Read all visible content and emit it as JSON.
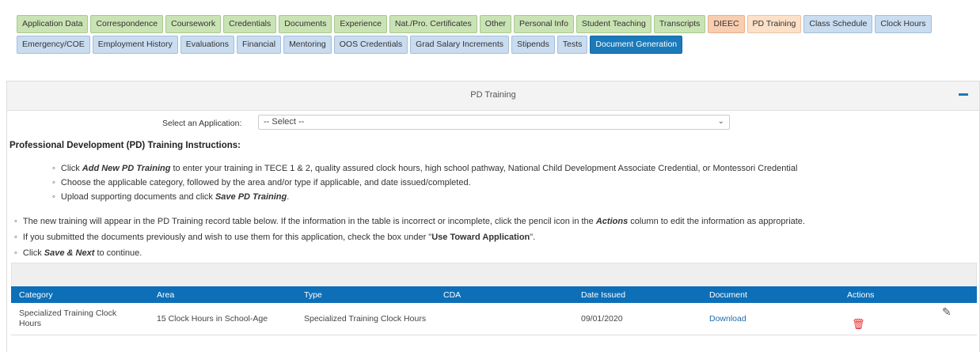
{
  "tabs": {
    "row1": [
      {
        "label": "Application Data",
        "color": "green"
      },
      {
        "label": "Correspondence",
        "color": "green"
      },
      {
        "label": "Coursework",
        "color": "green"
      },
      {
        "label": "Credentials",
        "color": "green"
      },
      {
        "label": "Documents",
        "color": "green"
      },
      {
        "label": "Experience",
        "color": "green"
      },
      {
        "label": "Nat./Pro. Certificates",
        "color": "green"
      },
      {
        "label": "Other",
        "color": "green"
      },
      {
        "label": "Personal Info",
        "color": "green"
      },
      {
        "label": "Student Teaching",
        "color": "green"
      },
      {
        "label": "Transcripts",
        "color": "green"
      },
      {
        "label": "DIEEC",
        "color": "orange"
      },
      {
        "label": "PD Training",
        "color": "peach"
      },
      {
        "label": "Class Schedule",
        "color": "blue"
      },
      {
        "label": "Clock Hours",
        "color": "blue"
      }
    ],
    "row2": [
      {
        "label": "Emergency/COE",
        "color": "blue"
      },
      {
        "label": "Employment History",
        "color": "blue"
      },
      {
        "label": "Evaluations",
        "color": "blue"
      },
      {
        "label": "Financial",
        "color": "blue"
      },
      {
        "label": "Mentoring",
        "color": "blue"
      },
      {
        "label": "OOS Credentials",
        "color": "blue"
      },
      {
        "label": "Grad Salary Increments",
        "color": "blue"
      },
      {
        "label": "Stipends",
        "color": "blue"
      },
      {
        "label": "Tests",
        "color": "blue"
      },
      {
        "label": "Document Generation",
        "color": "active"
      }
    ]
  },
  "panel": {
    "title": "PD Training"
  },
  "select": {
    "label": "Select an Application:",
    "value": "-- Select --"
  },
  "instructions": {
    "title": "Professional Development (PD) Training Instructions:",
    "sub": {
      "l1_a": "Click ",
      "l1_b": "Add New PD Training",
      "l1_c": " to enter your training in TECE 1 & 2, quality assured clock hours, high school pathway, National Child Development Associate Credential, or Montessori Credential",
      "l2": "Choose the applicable category, followed by the area and/or type if applicable, and date issued/completed.",
      "l3_a": "Upload supporting documents and click ",
      "l3_b": "Save PD Training",
      "l3_c": "."
    },
    "main": {
      "m1_a": "The new training will appear in the PD Training record table below. If the information in the table is incorrect or incomplete, click the pencil icon in the ",
      "m1_b": "Actions",
      "m1_c": " column to edit the information as appropriate.",
      "m2_a": "If you submitted the documents previously and wish to use them for this application, check the box under \"",
      "m2_b": "Use Toward Application",
      "m2_c": "\".",
      "m3_a": "Click ",
      "m3_b": "Save & Next",
      "m3_c": " to continue."
    }
  },
  "table": {
    "headers": [
      "Category",
      "Area",
      "Type",
      "CDA",
      "Date Issued",
      "Document",
      "Actions"
    ],
    "rows": [
      {
        "category": "Specialized Training Clock Hours",
        "area": "15 Clock Hours in School-Age",
        "type": "Specialized Training Clock Hours",
        "cda": "",
        "date_issued": "09/01/2020",
        "document": "Download"
      }
    ]
  },
  "icons": {
    "collapse": "minus-icon",
    "dropdown": "chevron-down-icon",
    "edit": "pencil-icon",
    "delete": "trash-icon"
  },
  "colors": {
    "accent": "#1b7ab9",
    "tab_green": "#c9e3b4",
    "tab_orange": "#f8cdb0",
    "tab_blue": "#c9dcf0",
    "delete_red": "#e03030"
  }
}
